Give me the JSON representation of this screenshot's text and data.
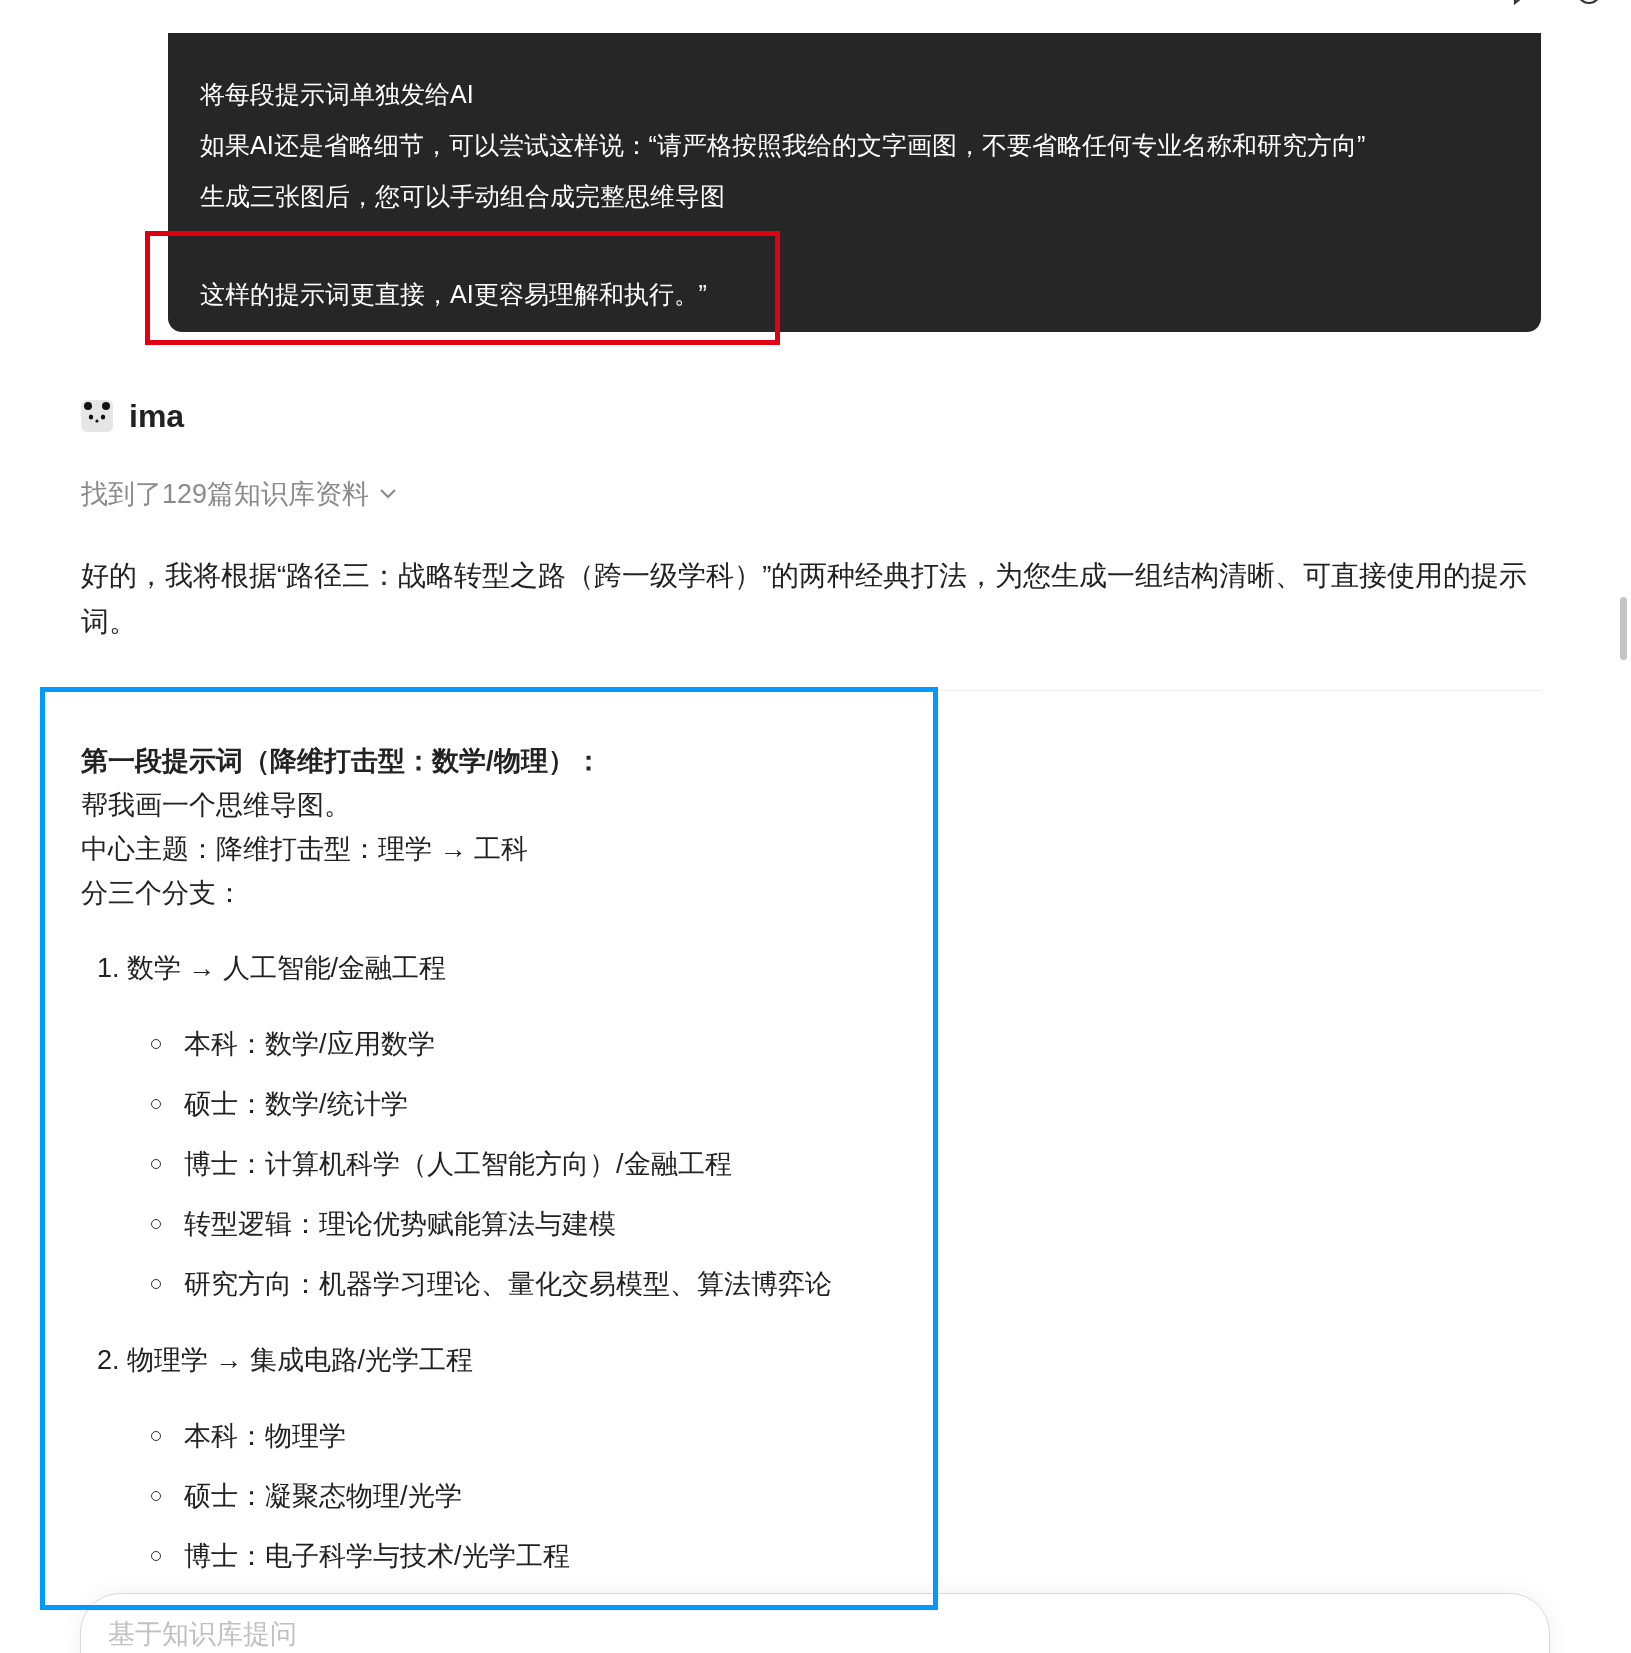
{
  "message_bubble": {
    "lines": [
      "将每段提示词单独发给AI",
      "如果AI还是省略细节，可以尝试这样说：“请严格按照我给的文字画图，不要省略任何专业名称和研究方向”",
      "生成三张图后，您可以手动组合成完整思维导图"
    ],
    "closing": "这样的提示词更直接，AI更容易理解和执行。”"
  },
  "assistant": {
    "name": "ima"
  },
  "sources": {
    "label": "找到了129篇知识库资料",
    "expanded": false
  },
  "intro": "好的，我将根据“路径三：战略转型之路（跨一级学科）”的两种经典打法，为您生成一组结构清晰、可直接使用的提示词。",
  "prompt": {
    "heading": "第一段提示词（降维打击型：数学/物理）：",
    "lines": [
      "帮我画一个思维导图。",
      "中心主题：降维打击型：理学 → 工科",
      "分三个分支："
    ],
    "branches": [
      {
        "number": "1.",
        "title": "数学 → 人工智能/金融工程",
        "children": [
          "本科：数学/应用数学",
          "硕士：数学/统计学",
          "博士：计算机科学（人工智能方向）/金融工程",
          "转型逻辑：理论优势赋能算法与建模",
          "研究方向：机器学习理论、量化交易模型、算法博弈论"
        ]
      },
      {
        "number": "2.",
        "title": "物理学 → 集成电路/光学工程",
        "children": [
          "本科：物理学",
          "硕士：凝聚态物理/光学",
          "博士：电子科学与技术/光学工程"
        ]
      }
    ]
  },
  "input": {
    "placeholder": "基于知识库提问"
  },
  "annotations": [
    {
      "kind": "frame",
      "color": "#e00012"
    },
    {
      "kind": "frame",
      "color": "#0099ff"
    }
  ]
}
